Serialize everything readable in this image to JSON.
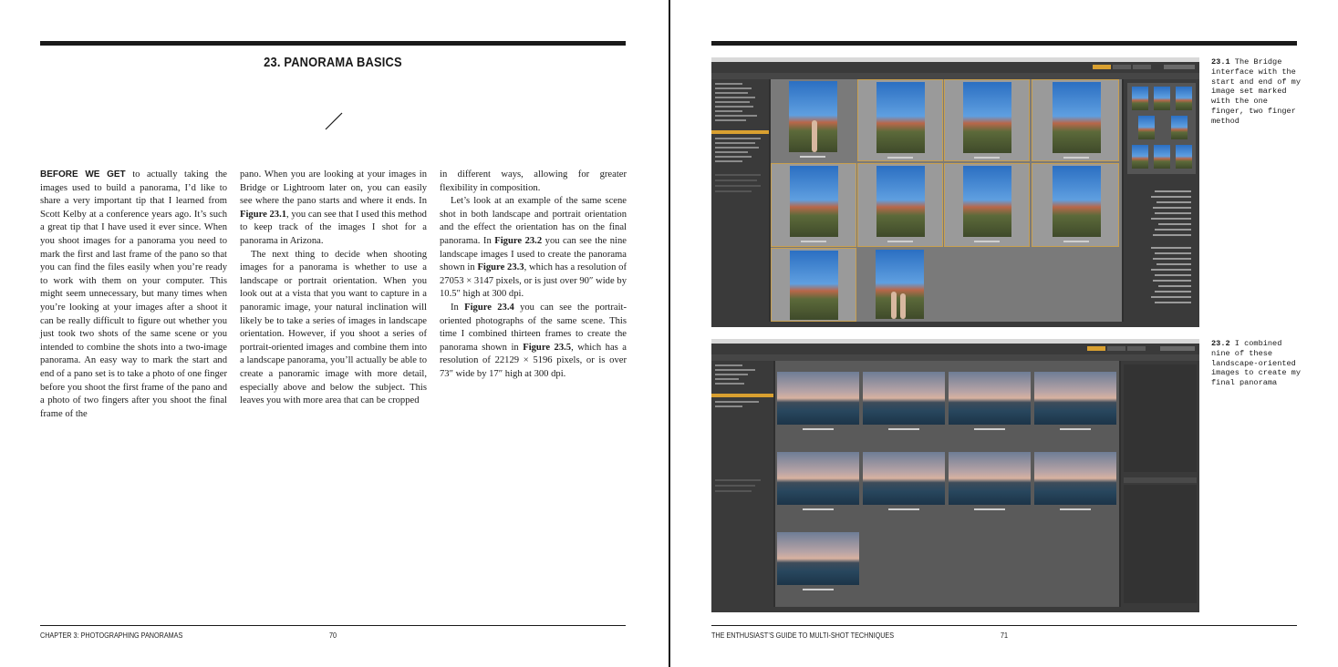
{
  "left_page": {
    "heading": "23. PANORAMA BASICS",
    "col1": {
      "lead": "BEFORE WE GET",
      "text": " to actually taking the images used to build a panorama, I’d like to share a very important tip that I learned from Scott Kelby at a conference years ago. It’s such a great tip that I have used it ever since. When you shoot images for a panorama you need to mark the first and last frame of the pano so that you can find the files easily when you’re ready to work with them on your computer. This might seem unnecessary, but many times when you’re looking at your images after a shoot it can be really difficult to figure out whether you just took two shots of the same scene or you intended to combine the shots into a two-image panorama. An easy way to mark the start and end of a pano set is to take a photo of one finger before you shoot the first frame of the pano and a photo of two fingers after you shoot the final frame of the"
    },
    "col2": {
      "p1_a": "pano. When you are looking at your images in Bridge or Lightroom later on, you can easily see where the pano starts and where it ends. In ",
      "p1_fig": "Figure 23.1",
      "p1_b": ", you can see that I used this method to keep track of the images I shot for a panorama in Arizona.",
      "p2": "The next thing to decide when shooting images for a panorama is whether to use a landscape or portrait orientation. When you look out at a vista that you want to capture in a panoramic image, your natural inclination will likely be to take a series of images in landscape orientation. However, if you shoot a series of portrait-oriented images and combine them into a landscape panorama, you’ll actually be able to create a panoramic image with more detail, especially above and below the subject. This leaves you with more area that can be cropped"
    },
    "col3": {
      "p1": "in different ways, allowing for greater flexibility in composition.",
      "p2_a": "Let’s look at an example of the same scene shot in both landscape and portrait orientation and the effect the orientation has on the final panorama. In ",
      "p2_fig1": "Figure 23.2",
      "p2_b": " you can see the nine landscape images I used to create the panorama shown in ",
      "p2_fig2": "Figure 23.3",
      "p2_c": ", which has a resolution of 27053 × 3147 pixels, or is just over 90″ wide by 10.5″ high at 300 dpi.",
      "p3_a": "In ",
      "p3_fig1": "Figure 23.4",
      "p3_b": " you can see the portrait-oriented photographs of the same scene. This time I combined thirteen frames to create the panorama shown in ",
      "p3_fig2": "Figure 23.5",
      "p3_c": ", which has a resolution of 22129 × 5196 pixels, or is over 73″ wide by 17″ high at 300 dpi."
    },
    "footer_chapter": "CHAPTER 3: PHOTOGRAPHING PANORAMAS",
    "footer_page": "70"
  },
  "right_page": {
    "caption1_num": "23.1",
    "caption1_text": " The Bridge interface with the start and end of my image set marked with the one finger, two finger method",
    "caption2_num": "23.2",
    "caption2_text": " I combined nine of these landscape-oriented images to create my final panorama",
    "footer_title": "THE ENTHUSIAST’S GUIDE TO MULTI-SHOT TECHNIQUES",
    "footer_page": "71"
  },
  "colors": {
    "rule": "#1a1a1a",
    "bridge_bg": "#2f2f2f",
    "bridge_panel": "#3a3a3a",
    "bridge_content": "#7a7a7a",
    "bridge_accent": "#d9a030"
  },
  "icons": [
    "slash-ornament-icon",
    "finger-icon",
    "two-fingers-icon"
  ]
}
